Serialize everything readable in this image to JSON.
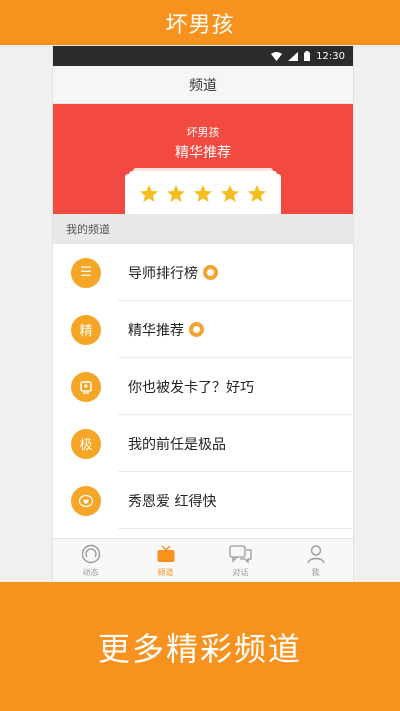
{
  "banner_top": {
    "title": "坏男孩"
  },
  "status_bar": {
    "time": "12:30"
  },
  "titlebar": {
    "title": "频道"
  },
  "hero": {
    "subtitle": "坏男孩",
    "title": "精华推荐",
    "rating_stars": 5
  },
  "section": {
    "title": "我的频道"
  },
  "channels": [
    {
      "icon_name": "list-icon",
      "icon_glyph": "☰",
      "label": "导师排行榜",
      "badge": true
    },
    {
      "icon_name": "essence-icon",
      "icon_glyph": "精",
      "label": "精华推荐",
      "badge": true
    },
    {
      "icon_name": "card-icon",
      "icon_glyph": "",
      "label": "你也被发卡了？好巧",
      "badge": false
    },
    {
      "icon_name": "extreme-icon",
      "icon_glyph": "极",
      "label": "我的前任是极品",
      "badge": false
    },
    {
      "icon_name": "heart-icon",
      "icon_glyph": "",
      "label": "秀恩爱 红得快",
      "badge": false
    }
  ],
  "tabs": [
    {
      "icon_name": "activity-icon",
      "label": "动态",
      "active": false
    },
    {
      "icon_name": "tv-icon",
      "label": "频道",
      "active": true
    },
    {
      "icon_name": "chat-icon",
      "label": "对话",
      "active": false
    },
    {
      "icon_name": "user-icon",
      "label": "我",
      "active": false
    }
  ],
  "banner_bottom": {
    "title": "更多精彩频道"
  },
  "colors": {
    "orange": "#f7921e",
    "hero_red": "#f24a40",
    "icon_orange": "#f6a626",
    "star_yellow": "#f5bd1f"
  }
}
